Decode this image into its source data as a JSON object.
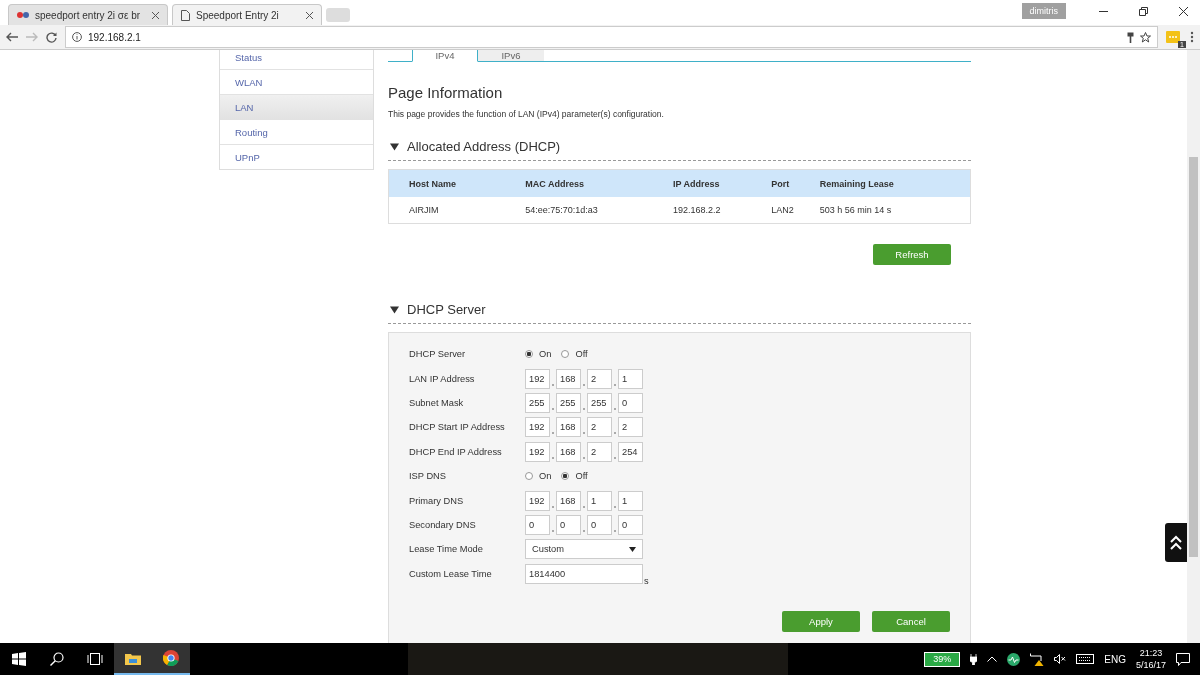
{
  "browser": {
    "tabs": [
      {
        "title": "speedport entry 2i σε br",
        "selected": false
      },
      {
        "title": "Speedport Entry 2i",
        "selected": true
      }
    ],
    "profile": "dimitris",
    "address": "192.168.2.1",
    "extension_badge": "1"
  },
  "sidebar": {
    "items": [
      {
        "label": "Status",
        "selected": false
      },
      {
        "label": "WLAN",
        "selected": false
      },
      {
        "label": "LAN",
        "selected": true
      },
      {
        "label": "Routing",
        "selected": false
      },
      {
        "label": "UPnP",
        "selected": false
      }
    ]
  },
  "tabs": [
    {
      "label": "IPv4",
      "selected": true
    },
    {
      "label": "IPv6",
      "selected": false
    }
  ],
  "page_title": "Page Information",
  "description": "This page provides the function of LAN (IPv4) parameter(s) configuration.",
  "allocated": {
    "title": "Allocated Address (DHCP)",
    "expanded": true,
    "columns": [
      "Host Name",
      "MAC Address",
      "IP Address",
      "Port",
      "Remaining Lease"
    ],
    "rows": [
      [
        "AIRJIM",
        "54:ee:75:70:1d:a3",
        "192.168.2.2",
        "LAN2",
        "503 h 56 min 14 s"
      ]
    ],
    "button": "Refresh"
  },
  "dhcp_server": {
    "title": "DHCP Server",
    "expanded": true,
    "fields": [
      {
        "kind": "radio",
        "label": "DHCP Server",
        "options": [
          {
            "label": "On",
            "selected": true
          },
          {
            "label": "Off",
            "selected": false
          }
        ]
      },
      {
        "kind": "ip",
        "label": "LAN IP Address",
        "octets": [
          "192",
          "168",
          "2",
          "1"
        ]
      },
      {
        "kind": "ip",
        "label": "Subnet Mask",
        "octets": [
          "255",
          "255",
          "255",
          "0"
        ]
      },
      {
        "kind": "ip",
        "label": "DHCP Start IP Address",
        "octets": [
          "192",
          "168",
          "2",
          "2"
        ]
      },
      {
        "kind": "ip",
        "label": "DHCP End IP Address",
        "octets": [
          "192",
          "168",
          "2",
          "254"
        ]
      },
      {
        "kind": "radio",
        "label": "ISP DNS",
        "options": [
          {
            "label": "On",
            "selected": false
          },
          {
            "label": "Off",
            "selected": true
          }
        ]
      },
      {
        "kind": "ip",
        "label": "Primary DNS",
        "octets": [
          "192",
          "168",
          "1",
          "1"
        ]
      },
      {
        "kind": "ip",
        "label": "Secondary DNS",
        "octets": [
          "0",
          "0",
          "0",
          "0"
        ]
      },
      {
        "kind": "select",
        "label": "Lease Time Mode",
        "value": "Custom"
      },
      {
        "kind": "text",
        "label": "Custom Lease Time",
        "value": "1814400",
        "suffix": "s"
      }
    ],
    "buttons": [
      "Apply",
      "Cancel"
    ]
  },
  "taskbar": {
    "battery": "39%",
    "language": "ENG",
    "time": "21:23",
    "date": "5/16/17"
  }
}
